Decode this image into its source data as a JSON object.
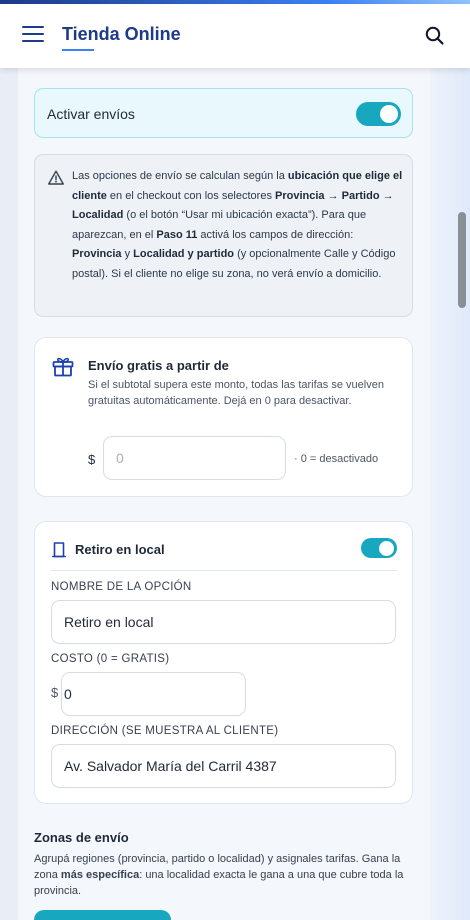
{
  "header": {
    "title": "Tienda Online",
    "menu_icon": "hamburger-menu-icon",
    "search_icon": "search-icon"
  },
  "shipping": {
    "enable_label": "Activar envíos",
    "enabled": true
  },
  "info": {
    "icon": "warning-icon",
    "segments": [
      {
        "text": "Las opciones de envío se calculan según la ",
        "bold": false
      },
      {
        "text": "ubicación que elige el cliente",
        "bold": true
      },
      {
        "text": " en el checkout con los selectores ",
        "bold": false
      },
      {
        "text": "Provincia → Partido → Localidad",
        "bold": true
      },
      {
        "text": " (o el botón “Usar mi ubicación exacta”). Para que aparezcan, en el ",
        "bold": false
      },
      {
        "text": "Paso 11",
        "bold": true
      },
      {
        "text": " activá los campos de dirección: ",
        "bold": false
      },
      {
        "text": "Provincia",
        "bold": true
      },
      {
        "text": " y ",
        "bold": false
      },
      {
        "text": "Localidad y partido",
        "bold": true
      },
      {
        "text": " (y opcionalmente Calle y Código postal). Si el cliente no elige su zona, no verá envío a domicilio.",
        "bold": false
      }
    ]
  },
  "free_shipping": {
    "icon": "gift-icon",
    "title": "Envío gratis a partir de",
    "description": "Si el subtotal supera este monto, todas las tarifas se vuelven gratuitas automáticamente. Dejá en 0 para desactivar.",
    "currency": "$",
    "placeholder": "0",
    "value": "",
    "hint": "· 0 = desactivado"
  },
  "pickup": {
    "icon": "store-icon",
    "title": "Retiro en local",
    "enabled": true,
    "name_label": "NOMBRE DE LA OPCIÓN",
    "name_value": "Retiro en local",
    "cost_label": "COSTO (0 = GRATIS)",
    "cost_currency": "$",
    "cost_value": "0",
    "address_label": "DIRECCIÓN (SE MUESTRA AL CLIENTE)",
    "address_value": "Av. Salvador María del Carril 4387"
  },
  "zones": {
    "title": "Zonas de envío",
    "description_segments": [
      {
        "text": "Agrupá regiones (provincia, partido o localidad) y asignales tarifas. Gana la zona ",
        "bold": false
      },
      {
        "text": "más específica",
        "bold": true
      },
      {
        "text": ": una localidad exacta le gana a una que cubre toda la provincia.",
        "bold": false
      }
    ]
  },
  "colors": {
    "brand": "#1e3a8a",
    "accent": "#17a8c0",
    "info_bg": "#eef2f7"
  }
}
